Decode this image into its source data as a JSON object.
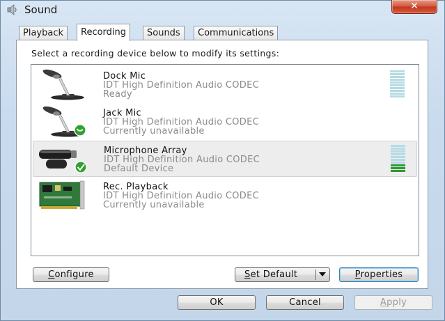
{
  "window": {
    "title": "Sound",
    "close_label": "✕"
  },
  "tabs": [
    {
      "label": "Playback"
    },
    {
      "label": "Recording",
      "active": true
    },
    {
      "label": "Sounds"
    },
    {
      "label": "Communications"
    }
  ],
  "instruction": "Select a recording device below to modify its settings:",
  "devices": [
    {
      "name": "Dock Mic",
      "description": "IDT High Definition Audio CODEC",
      "status": "Ready",
      "icon": "microphone-icon",
      "level": 0
    },
    {
      "name": "Jack Mic",
      "description": "IDT High Definition Audio CODEC",
      "status": "Currently unavailable",
      "icon": "microphone-unavailable-icon"
    },
    {
      "name": "Microphone Array",
      "description": "IDT High Definition Audio CODEC",
      "status": "Default Device",
      "icon": "microphone-array-default-icon",
      "selected": true,
      "level": 0.3
    },
    {
      "name": "Rec. Playback",
      "description": "IDT High Definition Audio CODEC",
      "status": "Currently unavailable",
      "icon": "sound-card-icon"
    }
  ],
  "buttons": {
    "configure": {
      "label_underlined": "C",
      "label_rest": "onfigure"
    },
    "set_default": {
      "label_underlined": "S",
      "label_rest": "et Default"
    },
    "properties": {
      "label_underlined": "P",
      "label_rest": "roperties"
    },
    "ok": "OK",
    "cancel": "Cancel",
    "apply": {
      "label_underlined": "A",
      "label_rest": "pply"
    }
  },
  "colors": {
    "meter_off": "#b6dbe4",
    "meter_on": "#2e9a34",
    "default_check": "#2fa12f",
    "close": "#c1381f"
  }
}
